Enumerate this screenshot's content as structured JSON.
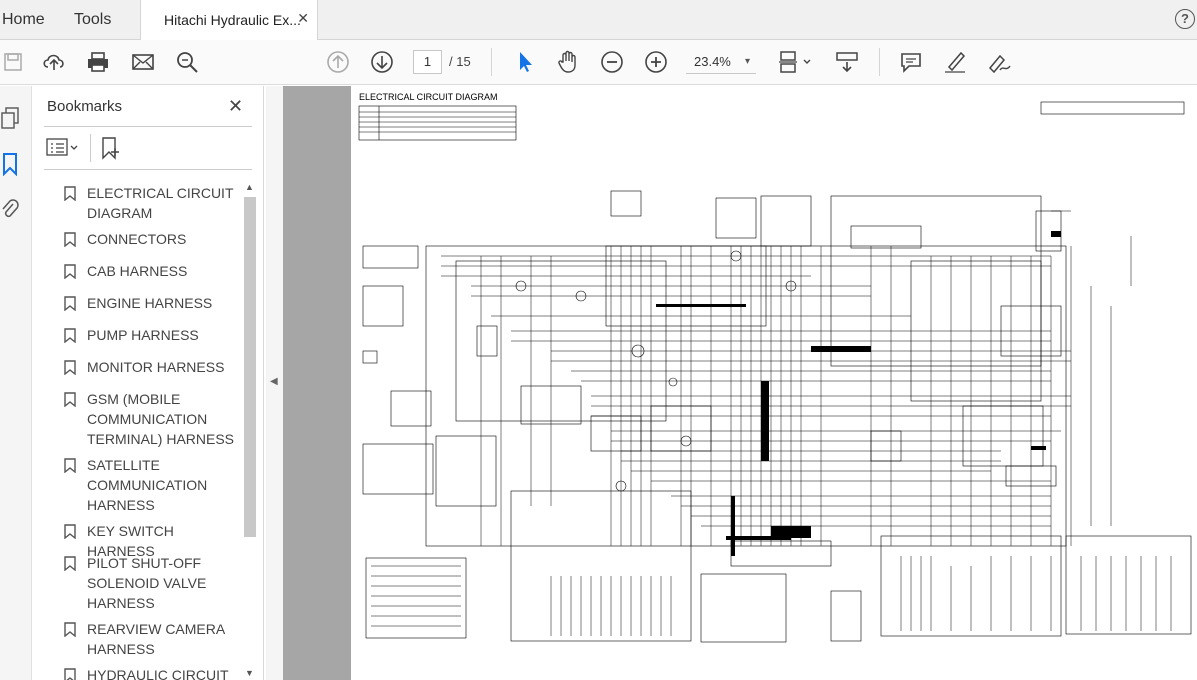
{
  "tabs": {
    "home": "Home",
    "tools": "Tools",
    "document": "Hitachi Hydraulic Ex...",
    "close_glyph": "✕",
    "help_glyph": "?"
  },
  "toolbar": {
    "page_current": "1",
    "page_total": "/ 15",
    "zoom": "23.4%",
    "zoom_caret": "▾"
  },
  "bookmarks_panel": {
    "title": "Bookmarks",
    "close_glyph": "✕",
    "collapse_glyph": "◀",
    "items": [
      {
        "label": "ELECTRICAL CIRCUIT DIAGRAM"
      },
      {
        "label": "CONNECTORS"
      },
      {
        "label": "CAB HARNESS"
      },
      {
        "label": "ENGINE HARNESS"
      },
      {
        "label": "PUMP HARNESS"
      },
      {
        "label": "MONITOR HARNESS"
      },
      {
        "label": "GSM (MOBILE COMMUNICATION TERMINAL) HARNESS"
      },
      {
        "label": "SATELLITE COMMUNICATION HARNESS"
      },
      {
        "label": "KEY SWITCH HARNESS"
      },
      {
        "label": "PILOT SHUT-OFF SOLENOID VALVE HARNESS"
      },
      {
        "label": "REARVIEW CAMERA HARNESS"
      },
      {
        "label": "HYDRAULIC CIRCUIT"
      }
    ]
  },
  "document": {
    "page_title": "ELECTRICAL CIRCUIT DIAGRAM"
  },
  "icons": {
    "save": "save-icon",
    "upload": "cloud-upload-icon",
    "print": "print-icon",
    "email": "mail-icon",
    "search": "search-icon",
    "prev_page": "arrow-up-circle-icon",
    "next_page": "arrow-down-circle-icon",
    "select": "cursor-arrow-icon",
    "hand": "hand-icon",
    "zoom_out": "zoom-out-icon",
    "zoom_in": "zoom-in-icon",
    "fit": "fit-page-icon",
    "scroll": "scroll-mode-icon",
    "comment": "comment-icon",
    "highlight": "pen-icon",
    "sign": "sign-icon"
  },
  "colors": {
    "accent": "#1473e6",
    "chrome": "#f0f0f0",
    "viewer_bg": "#a6a6a6"
  }
}
